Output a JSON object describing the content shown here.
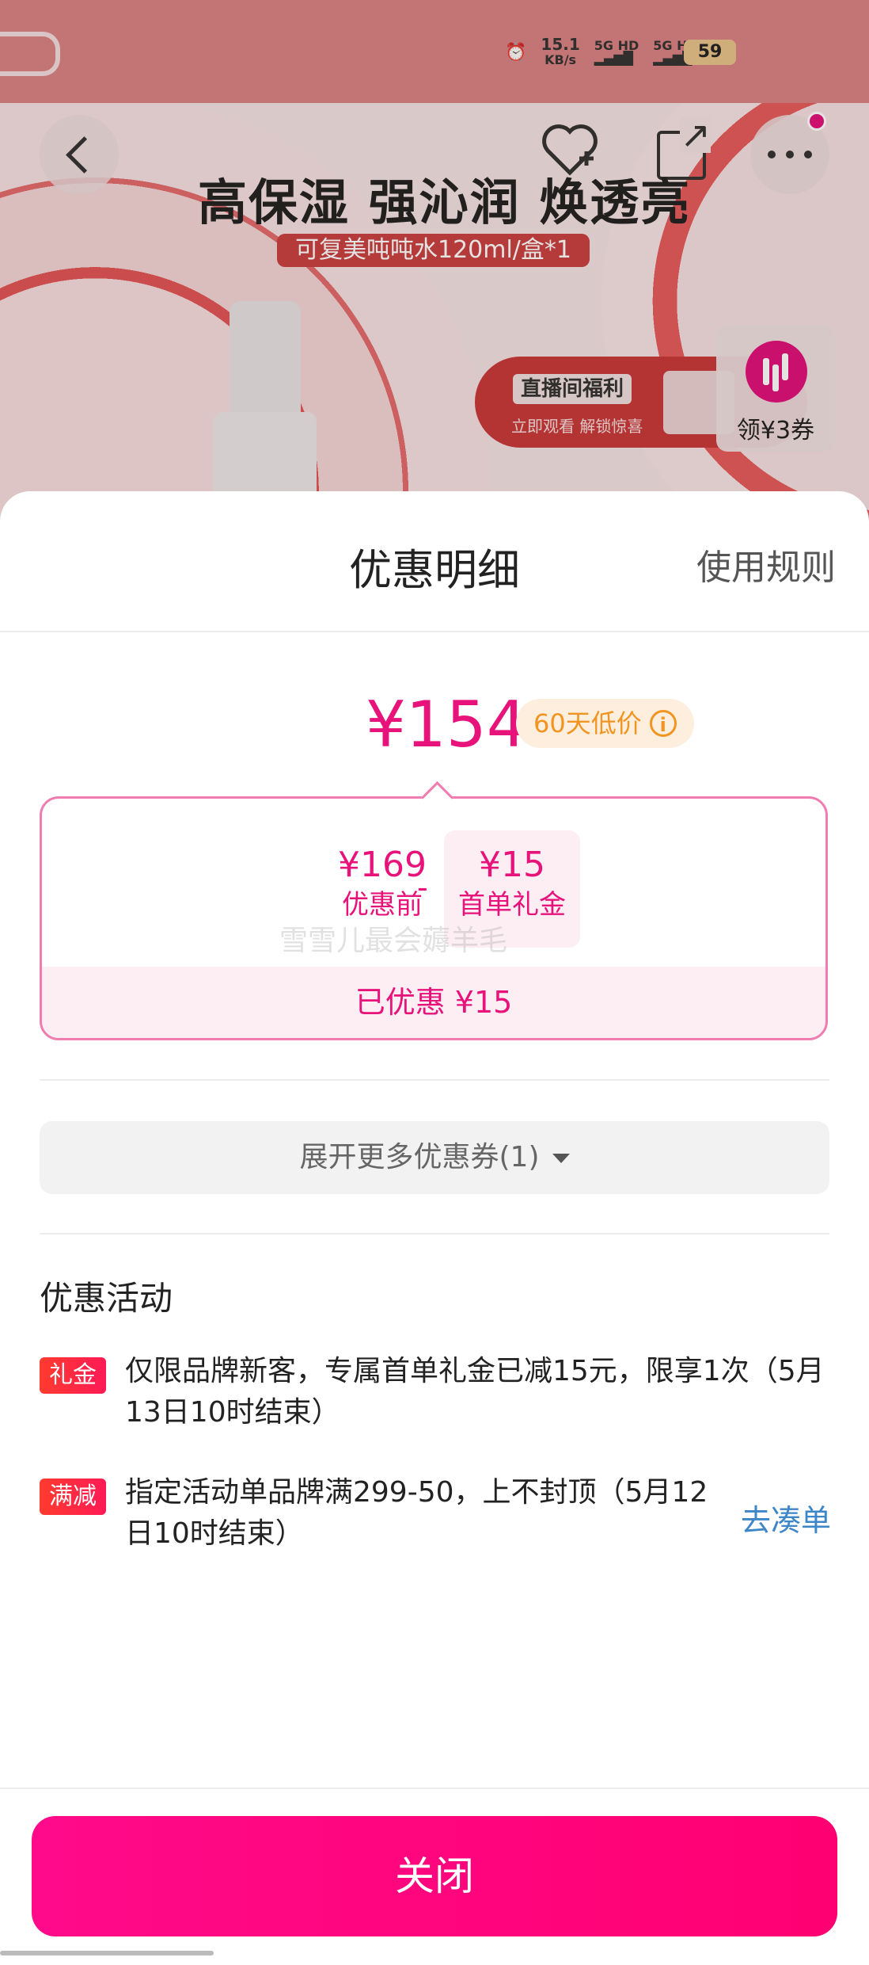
{
  "status_bar": {
    "net_speed": "15.1",
    "net_unit": "KB/s",
    "sim1": "5G HD",
    "sim2": "5G HD",
    "battery": "59"
  },
  "banner": {
    "title": "高保湿 强沁润 焕透亮",
    "subtitle": "可复美吨吨水120ml/盒*1",
    "live_title": "直播间福利",
    "live_sub": "立即观看 解锁惊喜",
    "coupon_chip": "领¥3券"
  },
  "sheet": {
    "title": "优惠明细",
    "rules_link": "使用规则",
    "price": "¥154",
    "low_badge": "60天低价",
    "breakdown": {
      "before_amount": "¥169",
      "before_label": "优惠前",
      "minus": "-",
      "gift_amount": "¥15",
      "gift_label": "首单礼金",
      "watermark": "雪雪儿最会薅羊毛",
      "saved": "已优惠 ¥15"
    },
    "expand_label": "展开更多优惠券(1)",
    "activities_title": "优惠活动",
    "activities": [
      {
        "tag": "礼金",
        "text": "仅限品牌新客，专属首单礼金已减15元，限享1次（5月13日10时结束）",
        "link": ""
      },
      {
        "tag": "满减",
        "text": "指定活动单品牌满299-50，上不封顶（5月12日10时结束）",
        "link": "去凑单"
      }
    ],
    "close_label": "关闭"
  },
  "colors": {
    "accent": "#e8127b",
    "badge_orange": "#f29422",
    "link_blue": "#3d86c8",
    "close_button": "#ff0a80"
  }
}
